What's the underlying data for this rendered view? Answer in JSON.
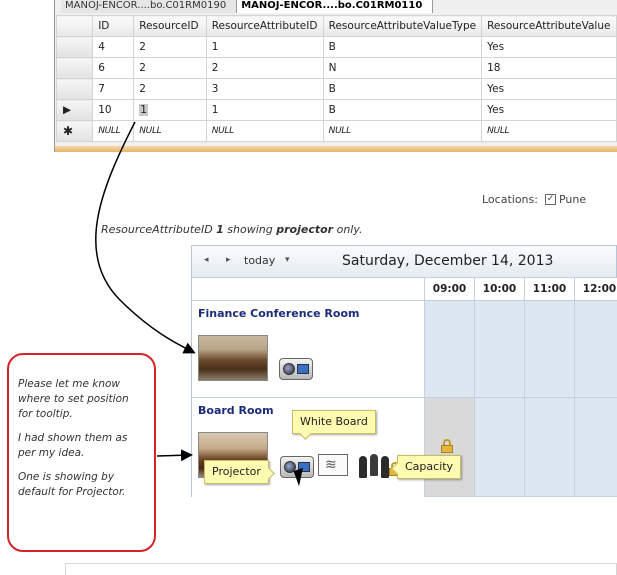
{
  "ssms": {
    "tabs": [
      "MANOJ-ENCOR....bo.C01RM0190",
      "MANOJ-ENCOR....bo.C01RM0110"
    ],
    "columns": [
      "ID",
      "ResourceID",
      "ResourceAttributeID",
      "ResourceAttributeValueType",
      "ResourceAttributeValue"
    ],
    "rows": [
      {
        "marker": "",
        "cells": [
          "4",
          "2",
          "1",
          "B",
          "Yes"
        ]
      },
      {
        "marker": "",
        "cells": [
          "6",
          "2",
          "2",
          "N",
          "18"
        ]
      },
      {
        "marker": "",
        "cells": [
          "7",
          "2",
          "3",
          "B",
          "Yes"
        ]
      },
      {
        "marker": "▶",
        "cells": [
          "10",
          "1",
          "1",
          "B",
          "Yes"
        ]
      },
      {
        "marker": "✱",
        "cells": [
          "NULL",
          "NULL",
          "NULL",
          "NULL",
          "NULL"
        ]
      }
    ]
  },
  "locations": {
    "label": "Locations:",
    "value": "Pune",
    "checked": true
  },
  "annotation": {
    "pre": "ResourceAttributeID ",
    "id": "1",
    "mid": " showing ",
    "item": "projector",
    "post": " only."
  },
  "scheduler": {
    "today_label": "today",
    "date": "Saturday, December 14, 2013",
    "hours": [
      "09:00",
      "10:00",
      "11:00",
      "12:00"
    ],
    "resources": [
      {
        "name": "Finance Conference Room"
      },
      {
        "name": "Board Room"
      }
    ]
  },
  "tooltips": {
    "white_board": "White Board",
    "projector": "Projector",
    "capacity": "Capacity"
  },
  "callout": [
    "Please let me know where to set position for tooltip.",
    "I had shown them as per my idea.",
    "One is showing by default for Projector."
  ],
  "icons": [
    "nav-prev-icon",
    "nav-next-icon",
    "dropdown-icon",
    "projector-icon",
    "whiteboard-icon",
    "people-icon",
    "lock-icon",
    "row-pointer-icon",
    "new-row-icon",
    "mouse-cursor-icon",
    "checkbox-icon"
  ],
  "colors": {
    "resource_name": "#1c2a7a",
    "slot": "#dce7f2",
    "tooltip": "#fffbb0",
    "callout_border": "#d5232a"
  }
}
